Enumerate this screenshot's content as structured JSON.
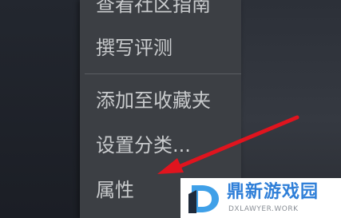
{
  "context_menu": {
    "items": [
      {
        "label": "查看社区指南"
      },
      {
        "label": "撰写评测"
      },
      {
        "label": "添加至收藏夹"
      },
      {
        "label": "设置分类..."
      },
      {
        "label": "属性"
      }
    ]
  },
  "annotation": {
    "arrow_color": "#e0141e",
    "points_to": "属性"
  },
  "watermark": {
    "title": "鼎新游戏园",
    "subtitle": "DXLAWYER.WORK",
    "accent": "#2f7fd8"
  }
}
